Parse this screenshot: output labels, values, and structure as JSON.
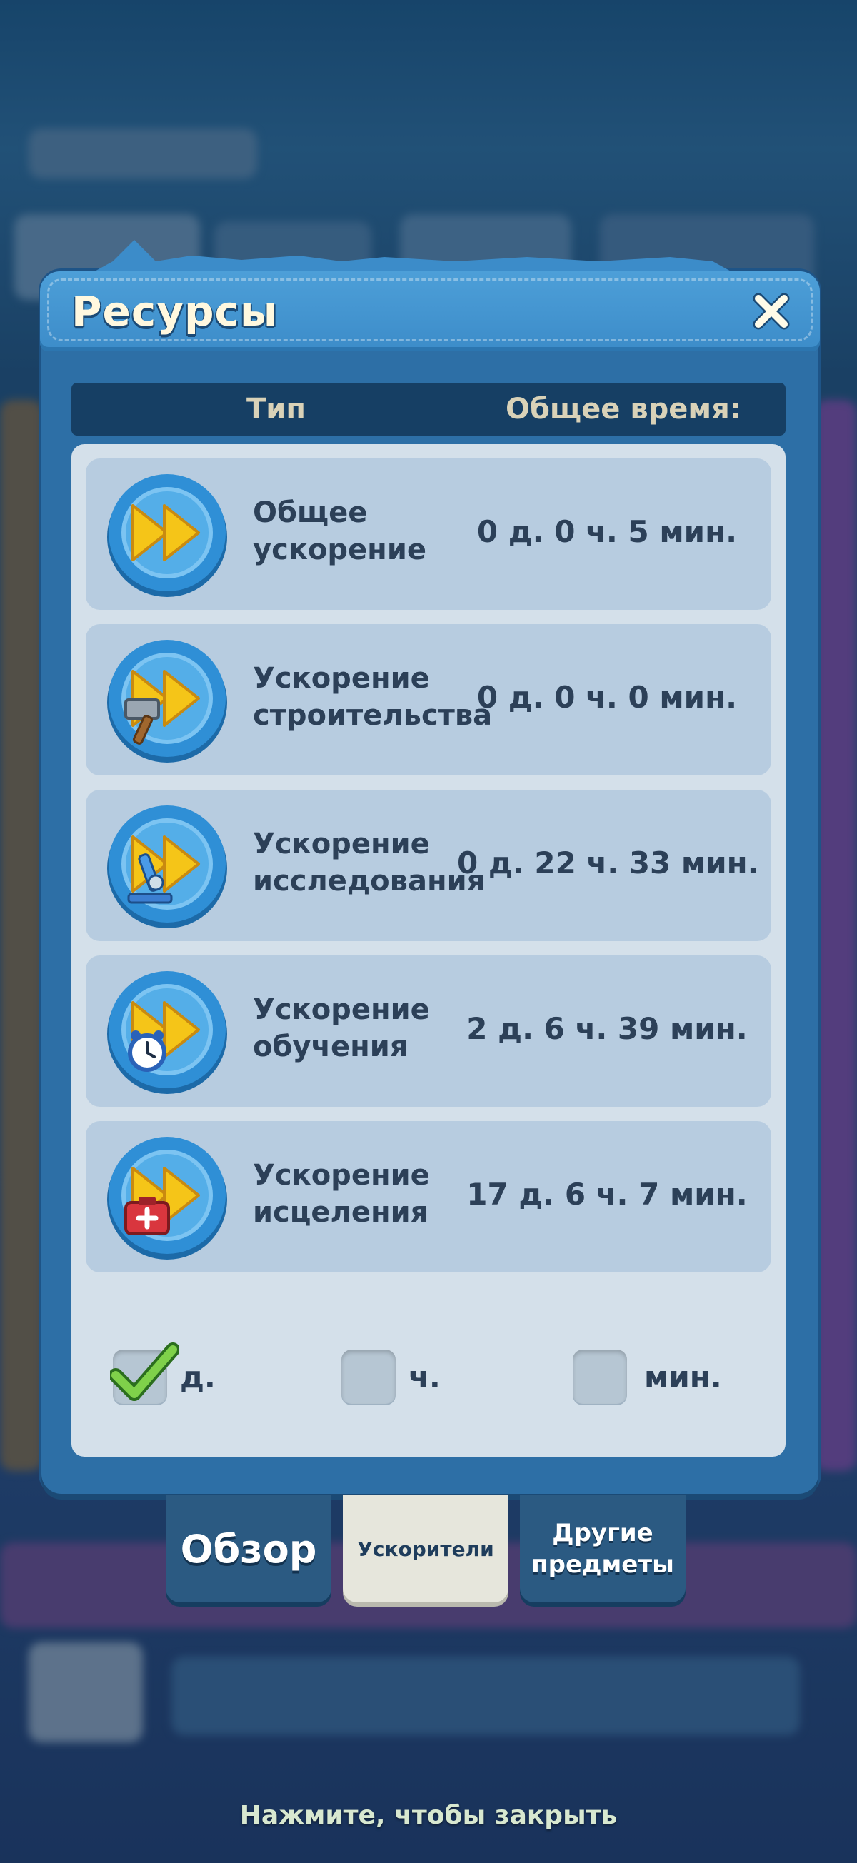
{
  "dialog": {
    "title": "Ресурсы",
    "close_icon": "close-icon"
  },
  "table": {
    "col_type": "Тип",
    "col_time": "Общее время:"
  },
  "rows": [
    {
      "name": "Общее ускорение",
      "time": "0 д. 0 ч. 5 мин.",
      "icon": "fast-forward-icon"
    },
    {
      "name": "Ускорение строительства",
      "time": "0 д. 0 ч. 0 мин.",
      "icon": "construction-speedup-icon"
    },
    {
      "name": "Ускорение исследования",
      "time": "0 д. 22 ч. 33 мин.",
      "icon": "research-speedup-icon"
    },
    {
      "name": "Ускорение обучения",
      "time": "2 д. 6 ч. 39 мин.",
      "icon": "training-speedup-icon"
    },
    {
      "name": "Ускорение исцеления",
      "time": "17 д. 6 ч. 7 мин.",
      "icon": "healing-speedup-icon"
    }
  ],
  "filters": [
    {
      "label": "д.",
      "checked": true
    },
    {
      "label": "ч.",
      "checked": false
    },
    {
      "label": "мин.",
      "checked": false
    }
  ],
  "tabs": [
    {
      "label": "Обзор",
      "active": false
    },
    {
      "label": "Ускорители",
      "active": true
    },
    {
      "label": "Другие предметы",
      "active": false
    }
  ],
  "hint": "Нажмите, чтобы закрыть",
  "colors": {
    "accent": "#3c8cc9",
    "row_bg": "#b7cce0",
    "panel_bg": "#d4e0ea",
    "text": "#2c4058",
    "icon_yellow": "#f5c518",
    "icon_blue": "#2f8fd6"
  }
}
